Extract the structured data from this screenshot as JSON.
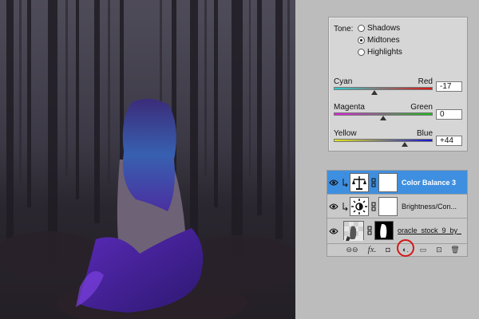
{
  "properties": {
    "tone_label": "Tone:",
    "tone_options": [
      {
        "label": "Shadows",
        "selected": false
      },
      {
        "label": "Midtones",
        "selected": true
      },
      {
        "label": "Highlights",
        "selected": false
      }
    ],
    "sliders": [
      {
        "left": "Cyan",
        "right": "Red",
        "value": "-17",
        "level": -17,
        "left_color": "#2ad0d0",
        "right_color": "#e01414"
      },
      {
        "left": "Magenta",
        "right": "Green",
        "value": "0",
        "level": 0,
        "left_color": "#e020e0",
        "right_color": "#18c018"
      },
      {
        "left": "Yellow",
        "right": "Blue",
        "value": "+44",
        "level": 44,
        "left_color": "#e6e614",
        "right_color": "#1414d8"
      }
    ]
  },
  "layers": {
    "items": [
      {
        "name": "Color Balance 3",
        "selected": true,
        "icon": "scale-icon"
      },
      {
        "name": "Brightness/Con...",
        "selected": false,
        "icon": "sun-icon"
      },
      {
        "name": "oracle_stock_9_by_...",
        "selected": false,
        "icon": "image-icon"
      }
    ],
    "toolbar": [
      {
        "name": "link-icon",
        "glyph": "⊖⊖"
      },
      {
        "name": "fx-icon",
        "glyph": "fx."
      },
      {
        "name": "mask-icon",
        "glyph": "◘"
      },
      {
        "name": "adjustment-icon",
        "glyph": "◐."
      },
      {
        "name": "group-icon",
        "glyph": "▭"
      },
      {
        "name": "new-layer-icon",
        "glyph": "⊡"
      },
      {
        "name": "trash-icon",
        "glyph": "🗑"
      }
    ]
  },
  "colors": {
    "selection_blue": "#3f8fe0",
    "highlight_circle": "#d21818",
    "panel_gray": "#bcbcbc"
  }
}
